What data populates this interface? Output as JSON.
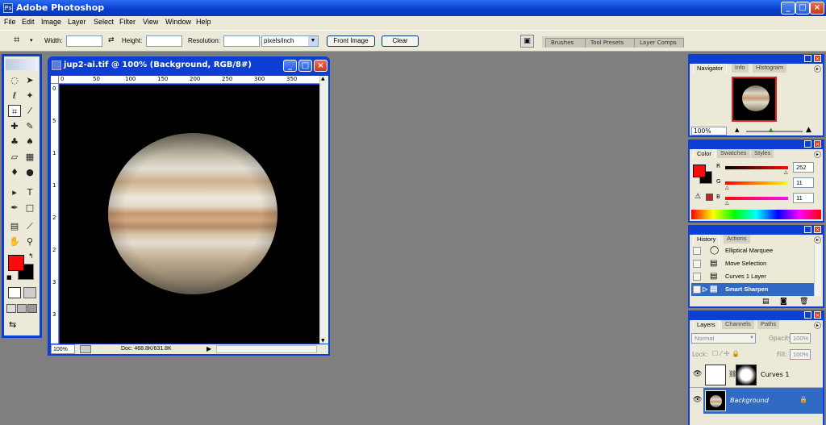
{
  "app": {
    "title": "Adobe Photoshop",
    "icon": "photoshop-app-icon"
  },
  "window_controls": {
    "minimize": "_",
    "maximize": "□",
    "close": "×"
  },
  "menu": [
    "File",
    "Edit",
    "Image",
    "Layer",
    "Select",
    "Filter",
    "View",
    "Window",
    "Help"
  ],
  "options": {
    "width_label": "Width:",
    "height_label": "Height:",
    "resolution_label": "Resolution:",
    "units_value": "pixels/inch",
    "front_image": "Front Image",
    "clear": "Clear",
    "tool_icon": "crop-icon"
  },
  "dock_tabs": [
    "Brushes",
    "Tool Presets",
    "Layer Comps"
  ],
  "document": {
    "title": "jup2-ai.tif @ 100% (Background, RGB/8#)",
    "ruler_top": [
      "0",
      "50",
      "100",
      "150",
      "200",
      "250",
      "300",
      "350"
    ],
    "ruler_left": [
      "0",
      "5",
      "1",
      "1",
      "2",
      "2",
      "3",
      "3"
    ],
    "zoom": "100%",
    "doc_info": "Doc: 468.8K/631.8K"
  },
  "navigator": {
    "tabs": [
      "Navigator",
      "Info",
      "Histogram"
    ],
    "zoom": "100%"
  },
  "color": {
    "tabs": [
      "Color",
      "Swatches",
      "Styles"
    ],
    "r_label": "R",
    "g_label": "G",
    "b_label": "B",
    "r": "252",
    "g": "11",
    "b": "11",
    "foreground": "#fc0b0b",
    "background": "#000000"
  },
  "history": {
    "tabs": [
      "History",
      "Actions"
    ],
    "items": [
      "Elliptical Marquee",
      "Move Selection",
      "Curves 1 Layer",
      "Smart Sharpen"
    ],
    "selected_index": 3
  },
  "layers": {
    "tabs": [
      "Layers",
      "Channels",
      "Paths"
    ],
    "blend_mode": "Normal",
    "opacity_label": "Opacity:",
    "opacity": "100%",
    "lock_label": "Lock:",
    "fill_label": "Fill:",
    "fill": "100%",
    "items": [
      "Curves 1",
      "Background"
    ]
  }
}
